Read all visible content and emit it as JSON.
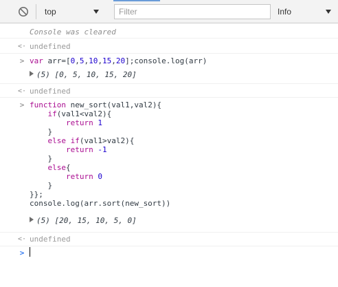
{
  "toolbar": {
    "context": "top",
    "filter_placeholder": "Filter",
    "level": "Info"
  },
  "console": {
    "cleared": "Console was cleared",
    "undefined_1": "undefined",
    "input_1": {
      "kw": "var",
      "a": " arr=[",
      "n0": "0",
      "c1": ",",
      "n5": "5",
      "c2": ",",
      "n10": "10",
      "c3": ",",
      "n15": "15",
      "c4": ",",
      "n20": "20",
      "b": "];console.log(arr)"
    },
    "output_1": "(5) [0, 5, 10, 15, 20]",
    "undefined_2": "undefined",
    "code": {
      "l1_kw": "function",
      "l1_rest": " new_sort(val1,val2){",
      "l2_kw": "if",
      "l2_rest": "(val1<val2){",
      "l3_kw": "return",
      "l3_num": "1",
      "l4": "}",
      "l5_kw1": "else",
      "l5_kw2": "if",
      "l5_rest": "(val1>val2){",
      "l6_kw": "return",
      "l6_num": "-1",
      "l7": "}",
      "l8_kw": "else",
      "l8_rest": "{",
      "l9_kw": "return",
      "l9_num": "0",
      "l10": "}",
      "l11": "}};",
      "l12": "console.log(arr.sort(new_sort))"
    },
    "output_2": "(5) [20, 15, 10, 5, 0]",
    "undefined_3": "undefined"
  }
}
